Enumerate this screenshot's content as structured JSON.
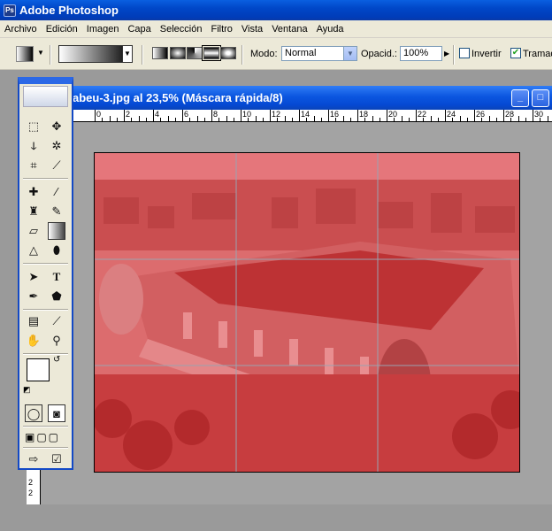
{
  "app": {
    "title": "Adobe Photoshop",
    "icon": "photoshop-icon",
    "accent": "#0047c8"
  },
  "menu": {
    "items": [
      "Archivo",
      "Edición",
      "Imagen",
      "Capa",
      "Selección",
      "Filtro",
      "Vista",
      "Ventana",
      "Ayuda"
    ]
  },
  "options": {
    "mode_label": "Modo:",
    "mode_value": "Normal",
    "opacity_label": "Opacid.:",
    "opacity_value": "100%",
    "invert_label": "Invertir",
    "invert_checked": false,
    "dither_label": "Tramad",
    "dither_checked": true,
    "gradient_types": [
      "lineal",
      "radial",
      "angular",
      "reflejado",
      "diamante"
    ],
    "gradient_selected": "reflejado"
  },
  "document": {
    "title": "abeu-3.jpg al 23,5% (Máscara rápida/8)",
    "ruler_top_labels": [
      "0",
      "2",
      "4",
      "6",
      "8",
      "10",
      "12",
      "14",
      "16",
      "18",
      "20",
      "22",
      "24",
      "26",
      "28",
      "30"
    ],
    "ruler_left_labels": [
      "2",
      "2"
    ],
    "overlay_color": "#e0262a"
  },
  "toolbox": {
    "tools": [
      "marquee-icon",
      "move-icon",
      "lasso-icon",
      "magic-wand-icon",
      "crop-icon",
      "eyedropper-slice-icon",
      "healing-icon",
      "brush-icon",
      "stamp-icon",
      "history-brush-icon",
      "eraser-icon",
      "gradient-icon",
      "blur-icon",
      "dodge-icon",
      "path-select-icon",
      "type-icon",
      "pen-icon",
      "shape-icon",
      "notes-icon",
      "eyedropper-icon",
      "hand-icon",
      "zoom-icon"
    ],
    "foreground_color": "#ffffff",
    "background_color": "#000000",
    "selected_tool": "gradient-icon"
  }
}
